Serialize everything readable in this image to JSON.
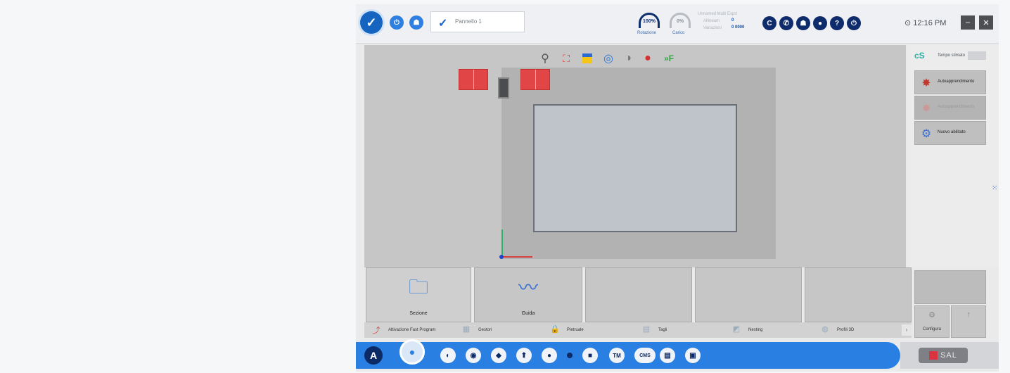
{
  "header": {
    "program_name": "Pannello 1",
    "gauge_rotation_value": "100%",
    "gauge_rotation_label": "Rotazione",
    "gauge_load_value": "0%",
    "gauge_load_label": "Carico",
    "info_title": "Unnamed Multi Exprt",
    "info_row1_label": "Allineam",
    "info_row1_value": "0",
    "info_row2_label": "Variazioni",
    "info_row2_value": "0  0000",
    "clock": "12:16 PM",
    "minimize_label": "–",
    "close_label": "✕"
  },
  "right_panel": {
    "logo_text": "cS",
    "time_label": "Tempo stimato",
    "buttons": [
      {
        "label": "Autoapprendimento",
        "icon": "gear-star-icon"
      },
      {
        "label": "Autoapprendimento",
        "icon": "gear-icon",
        "disabled": true
      },
      {
        "label": "Nuovo abilitato",
        "icon": "wrench-icon"
      }
    ]
  },
  "tiles": [
    {
      "label": "Sezione",
      "icon": "folder-icon"
    },
    {
      "label": "Guida",
      "icon": "graph-icon"
    },
    {
      "label": ""
    },
    {
      "label": ""
    },
    {
      "label": ""
    }
  ],
  "tabs": [
    {
      "label": "Attivazione Fast Program",
      "icon": "fast-icon"
    },
    {
      "label": "Gestori",
      "icon": "grid-icon"
    },
    {
      "label": "Pietruale",
      "icon": "lock-icon"
    },
    {
      "label": "Tagli",
      "icon": "cut-icon"
    },
    {
      "label": "Nesting",
      "icon": "nest-icon"
    },
    {
      "label": "Profili 3D",
      "icon": "3d-icon"
    }
  ],
  "config": {
    "configure_label": "Configura"
  },
  "dock": {
    "items": [
      "A",
      "●",
      "◐",
      "◉",
      "◆",
      "⬆",
      "●",
      "■",
      "TM",
      "CMS",
      "▤",
      "▣"
    ],
    "logo_text": "SAL"
  }
}
